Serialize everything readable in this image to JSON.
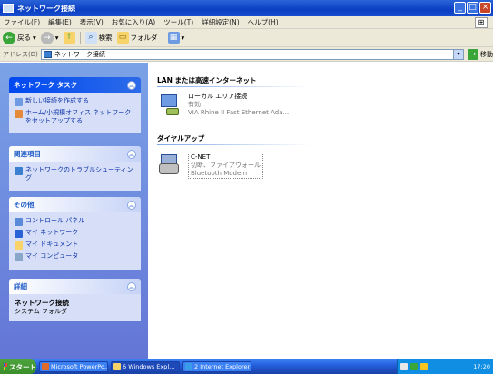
{
  "window": {
    "title": "ネットワーク接続",
    "controls": {
      "minimize": "_",
      "maximize": "□",
      "close": "×"
    }
  },
  "menubar": {
    "items": [
      "ファイル(F)",
      "編集(E)",
      "表示(V)",
      "お気に入り(A)",
      "ツール(T)",
      "詳細設定(N)",
      "ヘルプ(H)"
    ]
  },
  "toolbar": {
    "back_label": "戻る",
    "search_label": "検索",
    "folders_label": "フォルダ"
  },
  "address": {
    "label": "アドレス(D)",
    "value": "ネットワーク接続",
    "go_label": "移動"
  },
  "panels": {
    "network_tasks": {
      "title": "ネットワーク タスク",
      "items": [
        "新しい接続を作成する",
        "ホーム/小規模オフィス ネットワークをセットアップする"
      ]
    },
    "see_also": {
      "title": "関連項目",
      "items": [
        "ネットワークのトラブルシューティング"
      ]
    },
    "other_places": {
      "title": "その他",
      "items": [
        "コントロール パネル",
        "マイ ネットワーク",
        "マイ ドキュメント",
        "マイ コンピュータ"
      ]
    },
    "details": {
      "title": "詳細",
      "name": "ネットワーク接続",
      "sub": "システム フォルダ"
    }
  },
  "groups": {
    "lan": {
      "header": "LAN または高速インターネット",
      "connection": {
        "name": "ローカル エリア接続",
        "status": "有効",
        "device": "VIA Rhine II Fast Ethernet Ada..."
      }
    },
    "dialup": {
      "header": "ダイヤルアップ",
      "connection": {
        "name": "C-NET",
        "status": "切断、ファイアウォール",
        "device": "Bluetooth Modem"
      }
    }
  },
  "taskbar": {
    "start_label": "スタート",
    "buttons": [
      "Microsoft PowerPo...",
      "6 Windows Expl...",
      "2 Internet Explorer"
    ],
    "clock": "17:20"
  },
  "colors": {
    "titlebar": "#0a3fc2",
    "sidebar": "#6375d6",
    "taskbar": "#245edc",
    "start": "#3c8f2c"
  }
}
